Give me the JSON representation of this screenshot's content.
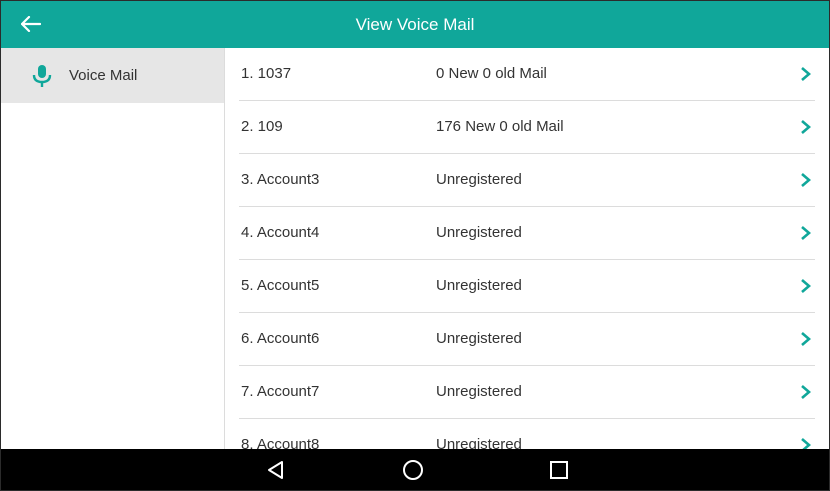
{
  "header": {
    "title": "View Voice Mail",
    "back_icon": "back-arrow-icon"
  },
  "sidebar": {
    "items": [
      {
        "label": "Voice Mail",
        "icon": "microphone-icon",
        "selected": true
      }
    ]
  },
  "accounts": [
    {
      "name": "1. 1037",
      "status": "0 New 0 old Mail"
    },
    {
      "name": "2. 109",
      "status": "176 New 0 old Mail"
    },
    {
      "name": "3. Account3",
      "status": "Unregistered"
    },
    {
      "name": "4. Account4",
      "status": "Unregistered"
    },
    {
      "name": "5. Account5",
      "status": "Unregistered"
    },
    {
      "name": "6. Account6",
      "status": "Unregistered"
    },
    {
      "name": "7. Account7",
      "status": "Unregistered"
    },
    {
      "name": "8. Account8",
      "status": "Unregistered"
    }
  ],
  "navbar": {
    "buttons": [
      "back-triangle-icon",
      "home-circle-icon",
      "recents-square-icon"
    ]
  },
  "colors": {
    "accent": "#10a79a",
    "selected_bg": "#e6e6e6",
    "navbar": "#000000"
  }
}
